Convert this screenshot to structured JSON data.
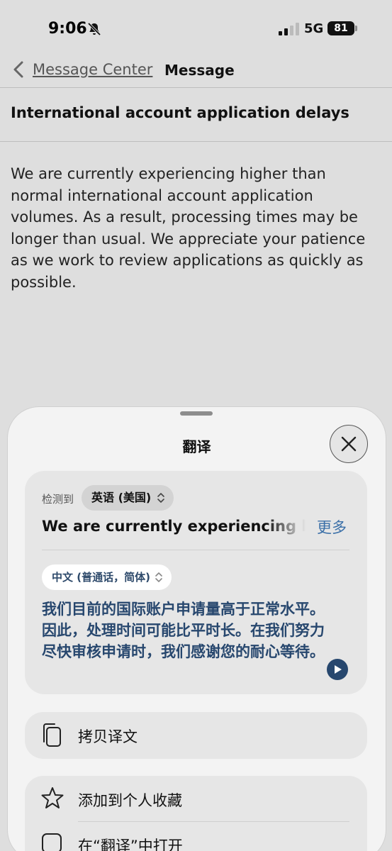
{
  "status": {
    "time": "9:06",
    "network": "5G",
    "battery": "81"
  },
  "nav": {
    "back_label": "Message Center",
    "title": "Message"
  },
  "message": {
    "subject": "International account application delays",
    "body": "We are currently experiencing higher than normal international account application volumes. As a result, processing times may be longer than usual. We appreciate your patience as we work to review applications as quickly as possible."
  },
  "translate_sheet": {
    "title": "翻译",
    "detected_label": "检测到",
    "source_language": "英语 (美国)",
    "source_text": "We are currently experiencing higher than normal international account application volumes.",
    "more_label": "更多",
    "target_language": "中文 (普通话，简体)",
    "target_text": "我们目前的国际账户申请量高于正常水平。因此，处理时间可能比平时长。在我们努力尽快审核申请时，我们感谢您的耐心等待。",
    "actions": {
      "copy": "拷贝译文",
      "favorite": "添加到个人收藏",
      "open_in_app": "在“翻译”中打开"
    }
  }
}
